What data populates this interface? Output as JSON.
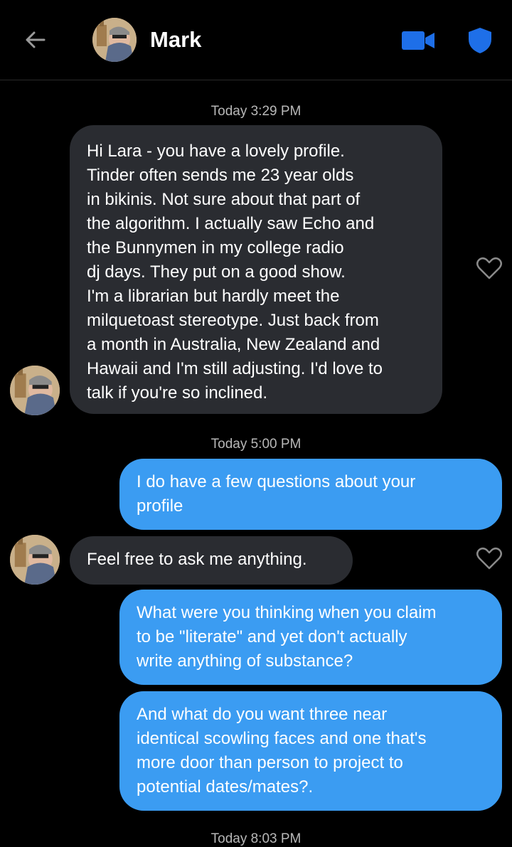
{
  "header": {
    "contact_name": "Mark",
    "icons": [
      "back-arrow-icon",
      "video-call-icon",
      "shield-icon"
    ],
    "accent": "#1e6fe8"
  },
  "messages": [
    {
      "type": "timestamp",
      "text": "Today 3:29 PM"
    },
    {
      "type": "incoming",
      "lines": [
        "Hi Lara - you have a lovely profile.",
        "Tinder often sends me 23 year olds",
        "in bikinis. Not sure about that part of",
        "the algorithm. I actually saw Echo and",
        "the Bunnymen in my college radio",
        "dj days. They put on a good show.",
        "I'm a librarian but hardly meet the",
        "milquetoast stereotype. Just back from",
        "a month in Australia, New Zealand and",
        "Hawaii and I'm still adjusting. I'd love to",
        "talk if you're so inclined."
      ]
    },
    {
      "type": "timestamp",
      "text": "Today 5:00 PM"
    },
    {
      "type": "outgoing",
      "lines": [
        "I do have a few questions about your",
        "profile"
      ]
    },
    {
      "type": "incoming",
      "lines": [
        "Feel free to ask me anything."
      ]
    },
    {
      "type": "outgoing",
      "lines": [
        "What were you thinking when you claim",
        "to be \"literate\" and yet don't actually",
        "write anything of substance?"
      ]
    },
    {
      "type": "outgoing",
      "lines": [
        "And what do you want three near",
        "identical scowling faces and one that's",
        "more door than person to project to",
        "potential dates/mates?."
      ]
    },
    {
      "type": "timestamp",
      "text": "Today 8:03 PM"
    }
  ],
  "colors": {
    "background": "#000000",
    "incoming_bubble": "#2a2c31",
    "outgoing_bubble": "#3b9cf2",
    "timestamp_text": "#b8b8b8"
  }
}
